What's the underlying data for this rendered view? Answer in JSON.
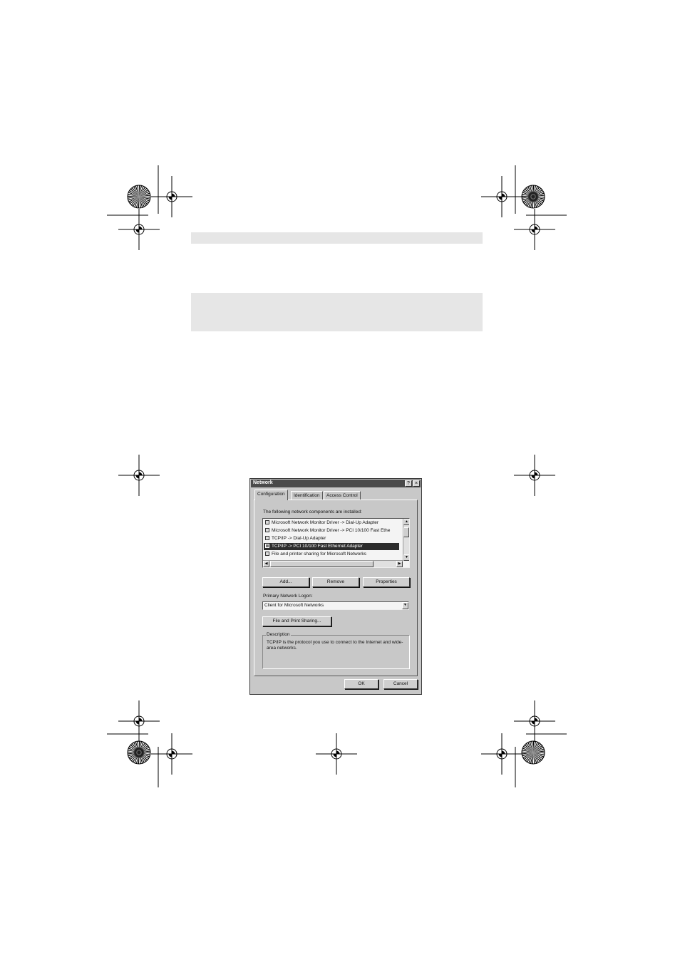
{
  "dialog": {
    "title": "Network",
    "help_button": "?",
    "close_button": "×",
    "tabs": [
      {
        "label": "Configuration"
      },
      {
        "label": "Identification"
      },
      {
        "label": "Access Control"
      }
    ],
    "components_label": "The following network components are installed:",
    "components": [
      {
        "label": "Microsoft Network Monitor Driver -> Dial-Up Adapter"
      },
      {
        "label": "Microsoft Network Monitor Driver -> PCI 10/100 Fast Ethe"
      },
      {
        "label": "TCP/IP -> Dial-Up Adapter"
      },
      {
        "label": "TCP/IP -> PCI 10/100 Fast Ethernet Adapter"
      },
      {
        "label": "File and printer sharing for Microsoft Networks"
      }
    ],
    "selected_index": 3,
    "buttons": {
      "add": "Add...",
      "remove": "Remove",
      "properties": "Properties",
      "file_print_sharing": "File and Print Sharing...",
      "ok": "OK",
      "cancel": "Cancel"
    },
    "primary_logon_label": "Primary Network Logon:",
    "primary_logon_value": "Client for Microsoft Networks",
    "description_title": "Description",
    "description_text": "TCP/IP is the protocol you use to connect to the Internet and wide-area networks."
  },
  "icons": [
    "registration-mark-icon",
    "starburst-target-icon",
    "dropdown-arrow-icon",
    "scroll-up-icon",
    "scroll-down-icon",
    "scroll-left-icon",
    "scroll-right-icon"
  ]
}
